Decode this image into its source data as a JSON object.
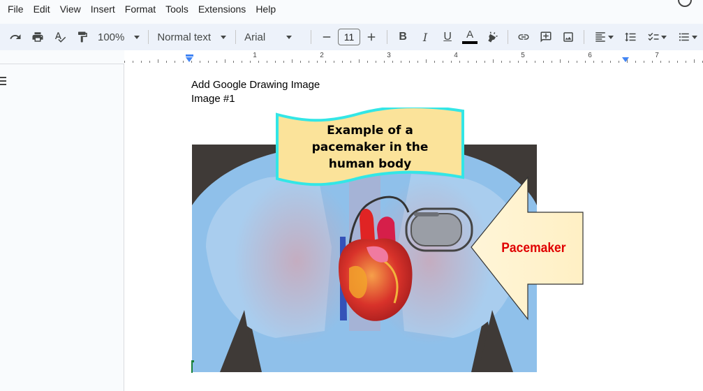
{
  "menu": [
    "File",
    "Edit",
    "View",
    "Insert",
    "Format",
    "Tools",
    "Extensions",
    "Help"
  ],
  "toolbar": {
    "zoom": "100%",
    "style": "Normal text",
    "font": "Arial",
    "font_size": "11",
    "bold": "B",
    "italic": "I",
    "underline": "U",
    "text_color": "A"
  },
  "ruler": {
    "numbers": [
      "1",
      "1",
      "2",
      "3",
      "4",
      "5",
      "6",
      "7"
    ]
  },
  "document": {
    "line1": "Add Google Drawing Image",
    "line2": "Image #1"
  },
  "drawing": {
    "banner_line1": "Example of a",
    "banner_line2": "pacemaker in the",
    "banner_line3": "human body",
    "arrow_label": "Pacemaker"
  },
  "colors": {
    "toolbar_bg": "#edf2fa",
    "banner_fill": "#fbe39a",
    "banner_outline": "#33e6e6",
    "arrow_fill": "#fff2cc",
    "arrow_label": "#e00000",
    "xray_dark": "#3f3a37",
    "body_blue": "#8fc0ea"
  }
}
